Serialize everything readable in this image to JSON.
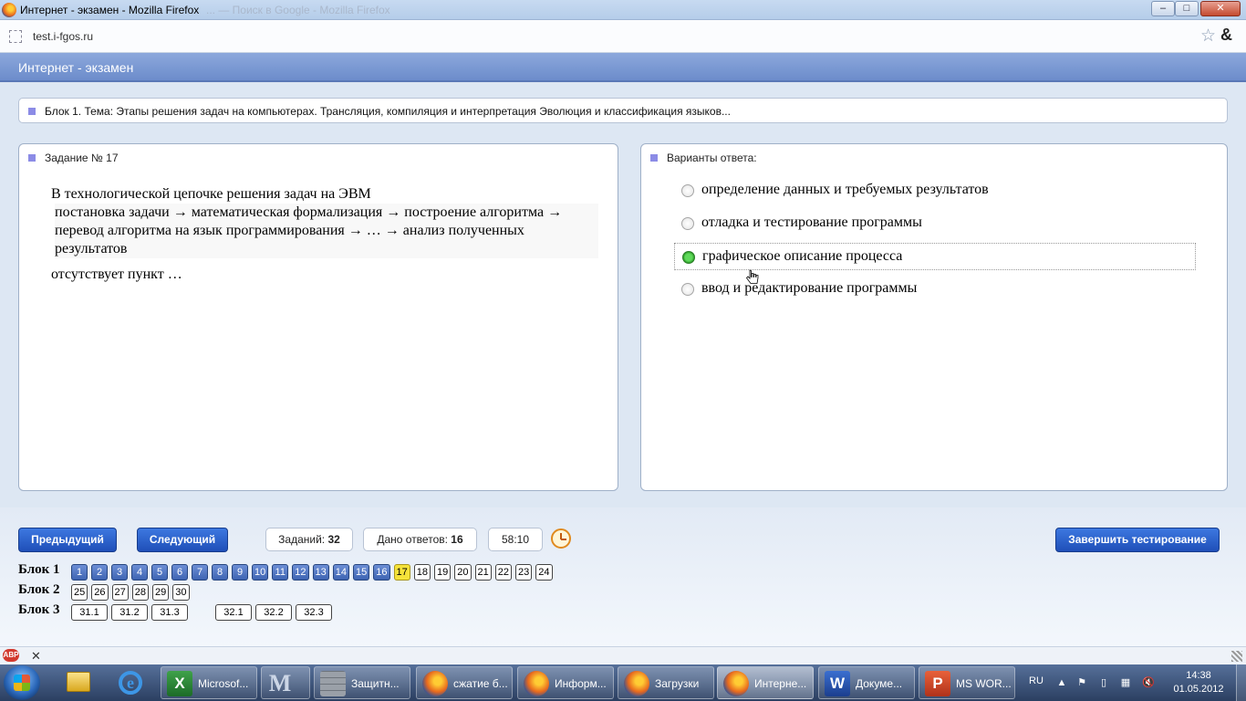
{
  "window": {
    "title": "Интернет - экзамен - Mozilla Firefox",
    "ghost_title": "... — Поиск в Google - Mozilla Firefox",
    "min_label": "–",
    "max_label": "□",
    "close_label": "✕"
  },
  "address_bar": {
    "url": "test.i-fgos.ru"
  },
  "page": {
    "header_title": "Интернет - экзамен",
    "block_topic": "Блок 1. Тема: Этапы решения задач на компьютерах. Трансляция, компиляция и интерпретация Эволюция и классификация языков..."
  },
  "task": {
    "heading": "Задание № 17",
    "line1": "В технологической цепочке решения задач на ЭВМ",
    "chain": "постановка задачи → математическая формализация → построение алгоритма → перевод алгоритма на язык программирования → … → анализ полученных результатов",
    "tail": "отсутствует пункт …"
  },
  "answers": {
    "heading": "Варианты ответа:",
    "options": [
      {
        "label": "определение данных и требуемых результатов",
        "checked": false
      },
      {
        "label": "отладка и тестирование программы",
        "checked": false
      },
      {
        "label": "графическое описание процесса",
        "checked": true
      },
      {
        "label": "ввод и редактирование программы",
        "checked": false
      }
    ]
  },
  "controls": {
    "prev_label": "Предыдущий",
    "next_label": "Следующий",
    "tasks_label": "Заданий:",
    "tasks_count": "32",
    "answered_label": "Дано ответов:",
    "answered_count": "16",
    "timer": "58:10",
    "finish_label": "Завершить тестирование"
  },
  "blocks": [
    {
      "label": "Блок 1",
      "items": [
        {
          "n": "1",
          "state": "done"
        },
        {
          "n": "2",
          "state": "done"
        },
        {
          "n": "3",
          "state": "done"
        },
        {
          "n": "4",
          "state": "done"
        },
        {
          "n": "5",
          "state": "done"
        },
        {
          "n": "6",
          "state": "done"
        },
        {
          "n": "7",
          "state": "done"
        },
        {
          "n": "8",
          "state": "done"
        },
        {
          "n": "9",
          "state": "done"
        },
        {
          "n": "10",
          "state": "done"
        },
        {
          "n": "11",
          "state": "done"
        },
        {
          "n": "12",
          "state": "done"
        },
        {
          "n": "13",
          "state": "done"
        },
        {
          "n": "14",
          "state": "done"
        },
        {
          "n": "15",
          "state": "done"
        },
        {
          "n": "16",
          "state": "done"
        },
        {
          "n": "17",
          "state": "current"
        },
        {
          "n": "18",
          "state": "open"
        },
        {
          "n": "19",
          "state": "open"
        },
        {
          "n": "20",
          "state": "open"
        },
        {
          "n": "21",
          "state": "open"
        },
        {
          "n": "22",
          "state": "open"
        },
        {
          "n": "23",
          "state": "open"
        },
        {
          "n": "24",
          "state": "open"
        }
      ]
    },
    {
      "label": "Блок 2",
      "items": [
        {
          "n": "25",
          "state": "open"
        },
        {
          "n": "26",
          "state": "open"
        },
        {
          "n": "27",
          "state": "open"
        },
        {
          "n": "28",
          "state": "open"
        },
        {
          "n": "29",
          "state": "open"
        },
        {
          "n": "30",
          "state": "open"
        }
      ]
    },
    {
      "label": "Блок 3",
      "items": [
        {
          "n": "31.1",
          "state": "open"
        },
        {
          "n": "31.2",
          "state": "open"
        },
        {
          "n": "31.3",
          "state": "open"
        },
        {
          "n": "",
          "state": "gap"
        },
        {
          "n": "32.1",
          "state": "open"
        },
        {
          "n": "32.2",
          "state": "open"
        },
        {
          "n": "32.3",
          "state": "open"
        }
      ]
    }
  ],
  "addon_bar": {
    "abp_label": "ABP",
    "close_label": "✕"
  },
  "taskbar": {
    "tasks": [
      {
        "icon": "excel-icon",
        "label": "Microsof...",
        "active": false
      },
      {
        "icon": "m-app-icon",
        "label": "",
        "active": false
      },
      {
        "icon": "wall-icon",
        "label": "Защитн...",
        "active": false
      },
      {
        "icon": "firefox-icon",
        "label": "сжатие б...",
        "active": false
      },
      {
        "icon": "firefox-icon",
        "label": "Информ...",
        "active": false
      },
      {
        "icon": "firefox-icon",
        "label": "Загрузки",
        "active": false
      },
      {
        "icon": "firefox-icon",
        "label": "Интерне...",
        "active": true
      },
      {
        "icon": "word-icon",
        "label": "Докуме...",
        "active": false
      },
      {
        "icon": "powerpoint-icon",
        "label": "MS WOR...",
        "active": false
      }
    ],
    "lang": "RU",
    "time": "14:38",
    "date": "01.05.2012"
  }
}
